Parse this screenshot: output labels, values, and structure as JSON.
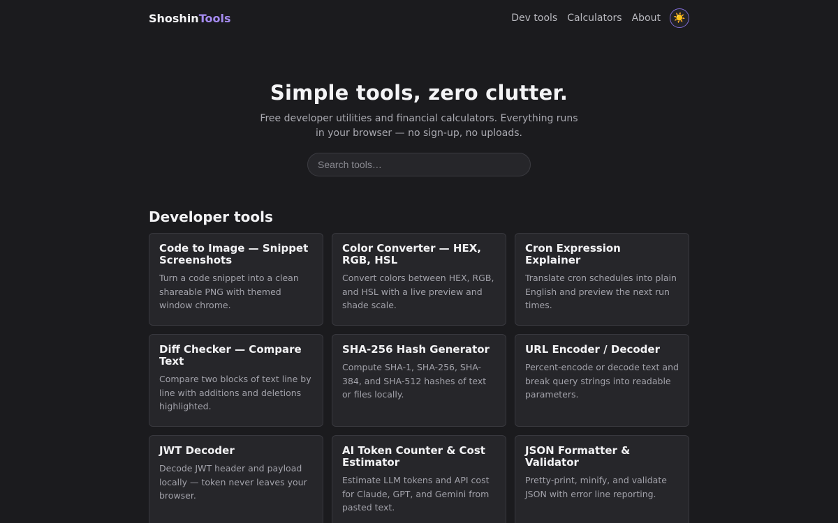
{
  "header": {
    "brand_main": "Shoshin",
    "brand_accent": "Tools",
    "nav": [
      {
        "label": "Dev tools"
      },
      {
        "label": "Calculators"
      },
      {
        "label": "About"
      }
    ],
    "theme_toggle_icon": "☀️"
  },
  "hero": {
    "title": "Simple tools, zero clutter.",
    "subtitle": "Free developer utilities and financial calculators. Everything runs in your browser — no sign-up, no uploads.",
    "search_placeholder": "Search tools…"
  },
  "section": {
    "title": "Developer tools",
    "cards": [
      {
        "title": "Code to Image — Snippet Screenshots",
        "description": "Turn a code snippet into a clean shareable PNG with themed window chrome."
      },
      {
        "title": "Color Converter — HEX, RGB, HSL",
        "description": "Convert colors between HEX, RGB, and HSL with a live preview and shade scale."
      },
      {
        "title": "Cron Expression Explainer",
        "description": "Translate cron schedules into plain English and preview the next run times."
      },
      {
        "title": "Diff Checker — Compare Text",
        "description": "Compare two blocks of text line by line with additions and deletions highlighted."
      },
      {
        "title": "SHA-256 Hash Generator",
        "description": "Compute SHA-1, SHA-256, SHA-384, and SHA-512 hashes of text or files locally."
      },
      {
        "title": "URL Encoder / Decoder",
        "description": "Percent-encode or decode text and break query strings into readable parameters."
      },
      {
        "title": "JWT Decoder",
        "description": "Decode JWT header and payload locally — token never leaves your browser."
      },
      {
        "title": "AI Token Counter & Cost Estimator",
        "description": "Estimate LLM tokens and API cost for Claude, GPT, and Gemini from pasted text."
      },
      {
        "title": "JSON Formatter & Validator",
        "description": "Pretty-print, minify, and validate JSON with error line reporting."
      }
    ]
  },
  "colors": {
    "background": "#1b1b1e",
    "card": "#26262a",
    "accent": "#a58bf0"
  }
}
